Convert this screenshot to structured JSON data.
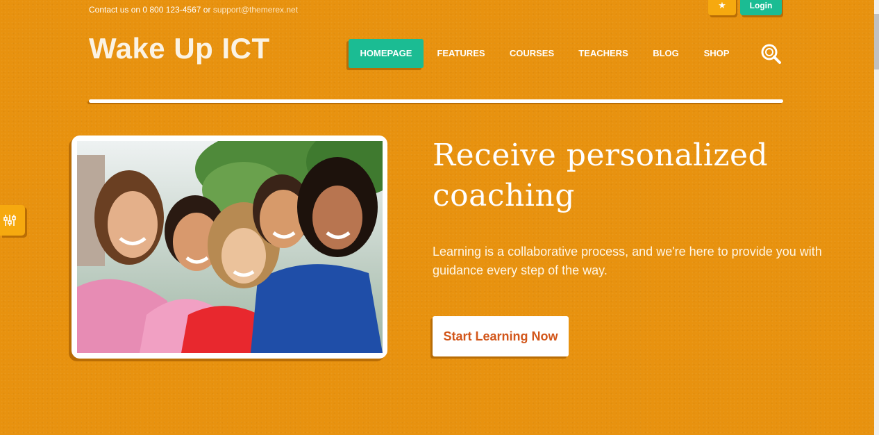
{
  "topbar": {
    "contact_prefix": "Contact us on 0 800 123-4567 or",
    "email": "support@themerex.net",
    "star_icon": "★",
    "login_label": "Login"
  },
  "header": {
    "logo": "Wake Up ICT",
    "nav": [
      {
        "label": "HOMEPAGE",
        "active": true
      },
      {
        "label": "FEATURES",
        "active": false
      },
      {
        "label": "COURSES",
        "active": false
      },
      {
        "label": "TEACHERS",
        "active": false
      },
      {
        "label": "BLOG",
        "active": false
      },
      {
        "label": "SHOP",
        "active": false
      }
    ],
    "search_icon": "search-icon"
  },
  "hero": {
    "headline": "Receive personalized coaching",
    "lead": "Learning is a collaborative process, and we're here to provide you with guidance every step of the way.",
    "cta_label": "Start Learning Now"
  },
  "colors": {
    "background": "#e8920f",
    "accent_green": "#1bbc93",
    "accent_yellow": "#f6a90f",
    "cta_text": "#d2561a"
  }
}
